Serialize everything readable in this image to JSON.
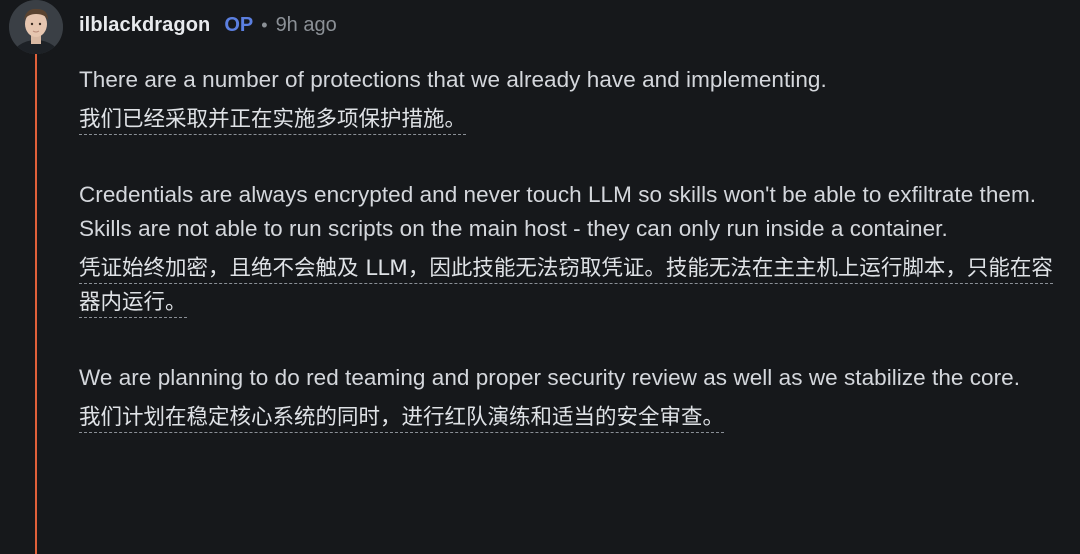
{
  "comment": {
    "author": "ilblackdragon",
    "badge": "OP",
    "separator": "•",
    "time": "9h ago"
  },
  "paragraphs": [
    {
      "original": "There are a number of protections that we already have and implementing.",
      "translation": "我们已经采取并正在实施多项保护措施。"
    },
    {
      "original": "Credentials are always encrypted and never touch LLM so skills won't be able to exfiltrate them. Skills are not able to run scripts on the main host - they can only run inside a container.",
      "translation": "凭证始终加密，且绝不会触及 LLM，因此技能无法窃取凭证。技能无法在主主机上运行脚本，只能在容器内运行。"
    },
    {
      "original": "We are planning to do red teaming and proper security review as well as we stabilize the core.",
      "translation": "我们计划在稳定核心系统的同时，进行红队演练和适当的安全审查。"
    }
  ],
  "colors": {
    "background": "#16181b",
    "thread_line": "#e0603a",
    "op_badge": "#5b7fe0",
    "muted": "#8b9096"
  }
}
